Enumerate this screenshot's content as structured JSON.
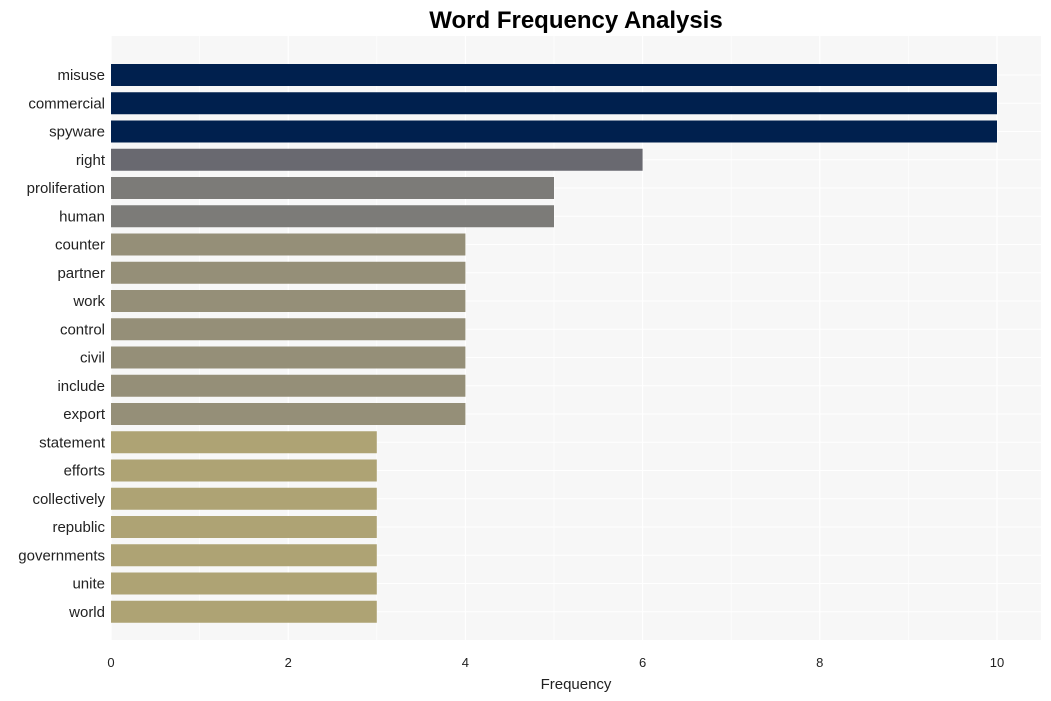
{
  "chart_data": {
    "type": "bar",
    "orientation": "horizontal",
    "title": "Word Frequency Analysis",
    "xlabel": "Frequency",
    "ylabel": "",
    "xlim": [
      0,
      10.5
    ],
    "xticks": [
      0,
      2,
      4,
      6,
      8,
      10
    ],
    "grid": true,
    "legend": "none",
    "categories": [
      "misuse",
      "commercial",
      "spyware",
      "right",
      "proliferation",
      "human",
      "counter",
      "partner",
      "work",
      "control",
      "civil",
      "include",
      "export",
      "statement",
      "efforts",
      "collectively",
      "republic",
      "governments",
      "unite",
      "world"
    ],
    "values": [
      10,
      10,
      10,
      6,
      5,
      5,
      4,
      4,
      4,
      4,
      4,
      4,
      4,
      3,
      3,
      3,
      3,
      3,
      3,
      3
    ],
    "colors": [
      "#00204e",
      "#00204e",
      "#00204e",
      "#696970",
      "#7c7b78",
      "#7c7b78",
      "#958f78",
      "#958f78",
      "#958f78",
      "#958f78",
      "#958f78",
      "#958f78",
      "#958f78",
      "#aea374",
      "#aea374",
      "#aea374",
      "#aea374",
      "#aea374",
      "#aea374",
      "#aea374"
    ]
  }
}
